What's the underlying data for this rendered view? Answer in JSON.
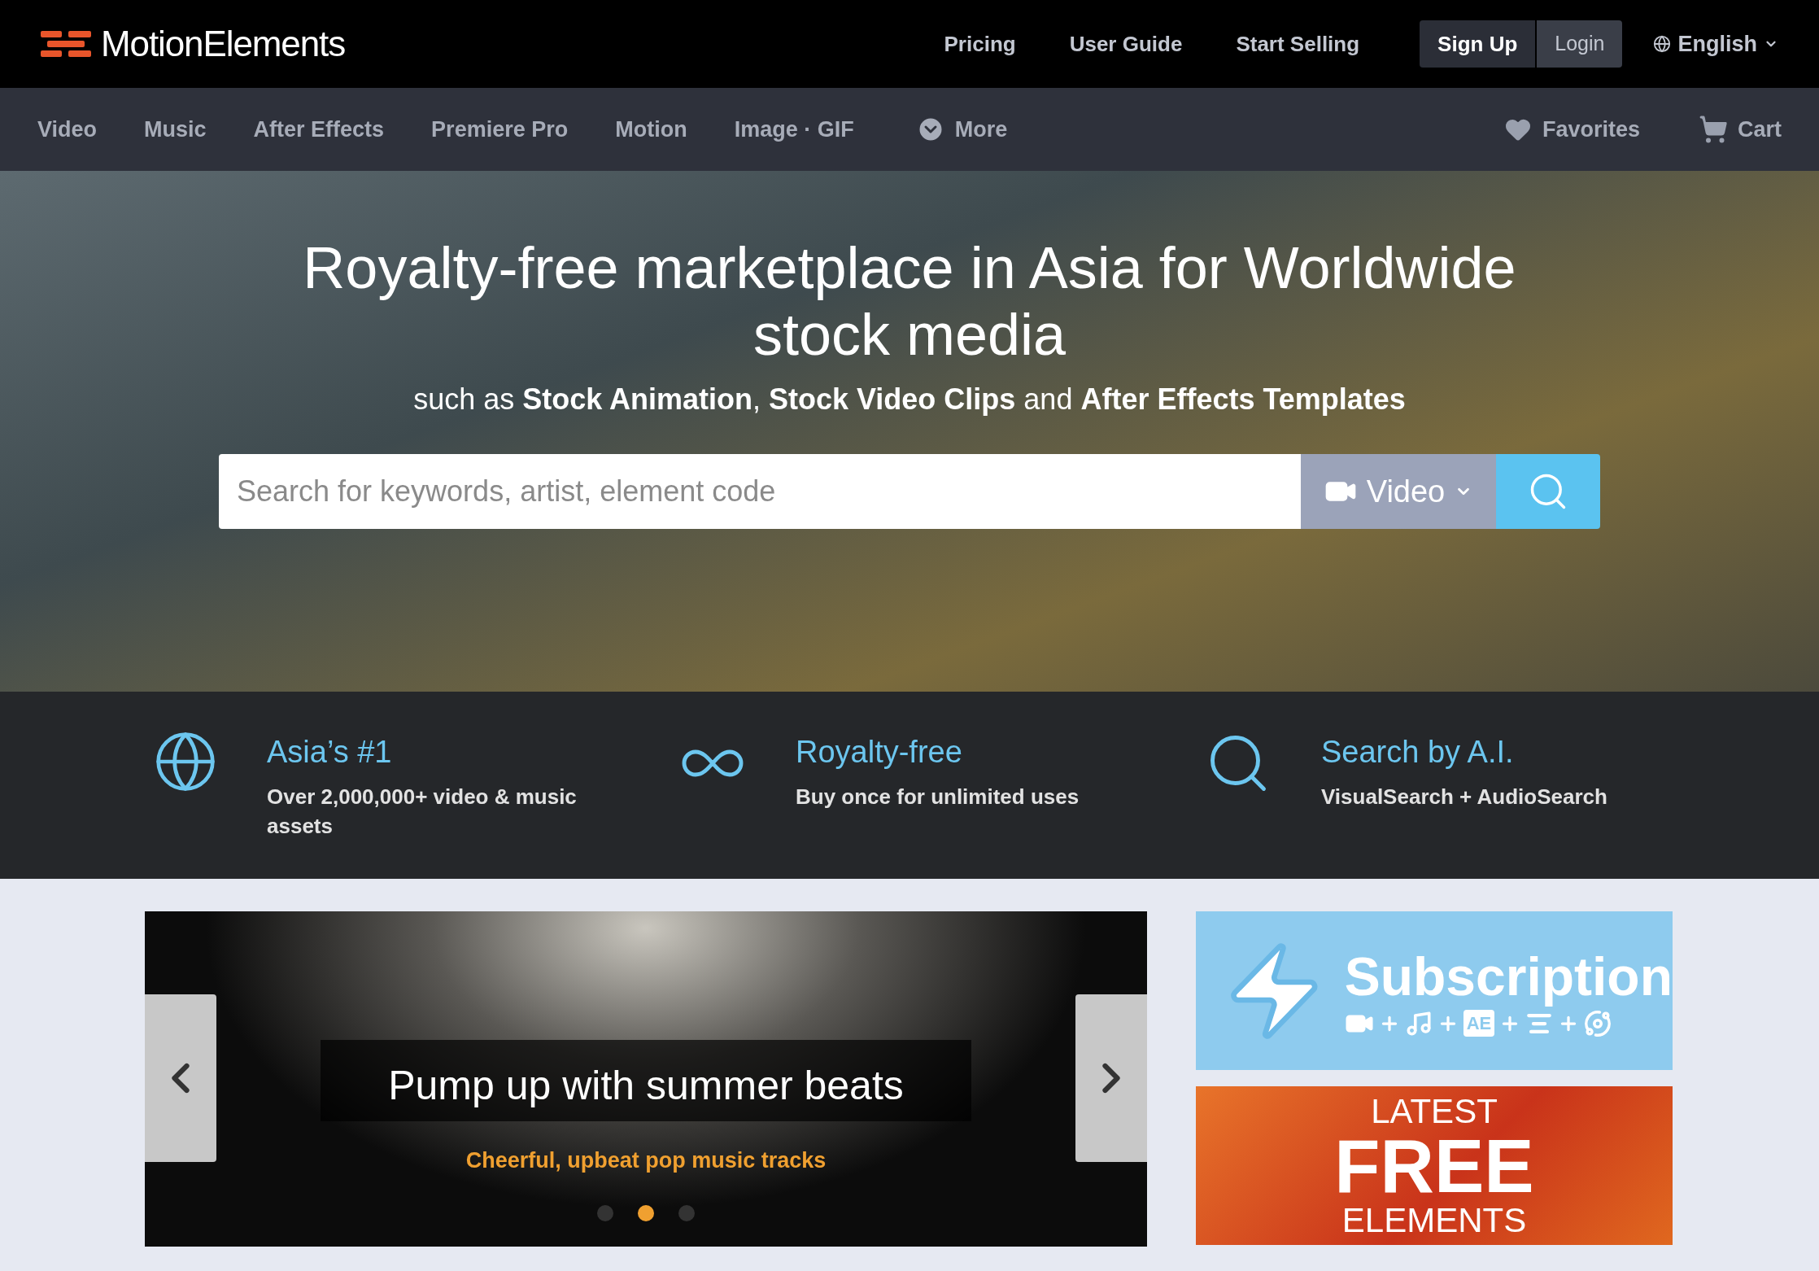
{
  "header": {
    "logo": "MotionElements",
    "links": [
      "Pricing",
      "User Guide",
      "Start Selling"
    ],
    "signup": "Sign Up",
    "login": "Login",
    "language": "English"
  },
  "nav": {
    "items": [
      {
        "label": "Video",
        "kind": "link"
      },
      {
        "label": "Music",
        "kind": "link"
      },
      {
        "label": "After Effects",
        "kind": "link"
      },
      {
        "label": "Premiere Pro",
        "kind": "link"
      },
      {
        "label": "Motion",
        "kind": "link"
      },
      {
        "label": "Image · GIF",
        "kind": "link"
      },
      {
        "label": "More",
        "kind": "dropdown"
      }
    ],
    "right": [
      {
        "label": "Favorites",
        "kind": "heart"
      },
      {
        "label": "Cart",
        "kind": "cart"
      }
    ]
  },
  "hero": {
    "title": "Royalty-free marketplace in Asia for Worldwide stock media",
    "subtitle": "such as **Stock Animation**, **Stock Video Clips** and **After Effects Templates**",
    "search": {
      "placeholder": "Search for keywords, artist, element code",
      "category": "Video"
    }
  },
  "features": [
    {
      "kind": "globe",
      "title": "Asia’s #1",
      "text": "Over 2,000,000+ video & music assets"
    },
    {
      "kind": "loop",
      "title": "Royalty-free",
      "text": "Buy once for unlimited uses"
    },
    {
      "kind": "search",
      "title": "Search by A.I.",
      "text": "VisualSearch + AudioSearch"
    }
  ],
  "carousel": {
    "title": "Pump up with summer beats",
    "subtitle": "Cheerful, upbeat pop music tracks",
    "dots": [
      {
        "selected": false
      },
      {
        "selected": true
      },
      {
        "selected": false
      }
    ]
  },
  "banners": [
    {
      "kind": "subscription",
      "title": "Subscription",
      "badge": "AE"
    },
    {
      "kind": "free",
      "lines": [
        "LATEST",
        "FREE",
        "ELEMENTS"
      ]
    }
  ]
}
